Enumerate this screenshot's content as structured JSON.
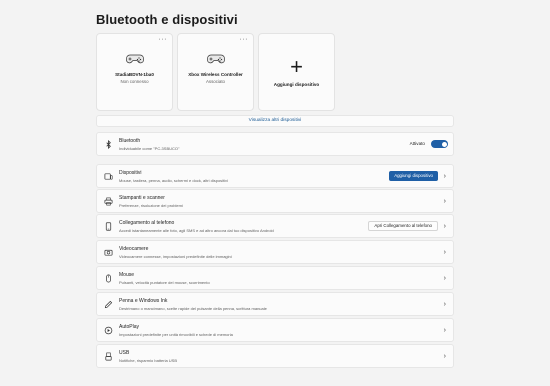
{
  "page": {
    "title": "Bluetooth e dispositivi"
  },
  "devices": [
    {
      "name": "StadiaBDVN-1ba0",
      "status": "Non connesso",
      "icon": "gamepad-icon"
    },
    {
      "name": "Xbox Wireless Controller",
      "status": "Associato",
      "icon": "gamepad-icon"
    }
  ],
  "add_card": {
    "label": "Aggiungi dispositivo",
    "icon": "plus-icon"
  },
  "view_more": "Visualizza altri dispositivi",
  "bluetooth": {
    "title": "Bluetooth",
    "desc": "Individuabile come \"PC-3SBUCO\"",
    "toggle_label": "Attivato",
    "toggle_on": true
  },
  "rows": [
    {
      "id": "dispositivi",
      "title": "Dispositivi",
      "desc": "Mouse, tastiera, penna, audio, schermi e dock, altri dispositivi",
      "button": "Aggiungi dispositivo",
      "button_style": "accent"
    },
    {
      "id": "stampanti",
      "title": "Stampanti e scanner",
      "desc": "Preferenze, risoluzione dei problemi"
    },
    {
      "id": "telefono",
      "title": "Collegamento al telefono",
      "desc": "Accedi istantaneamente alle foto, agli SMS e ad altro ancora dal tuo dispositivo Android",
      "button": "Apri Collegamento al telefono",
      "button_style": "standard"
    },
    {
      "id": "videocamere",
      "title": "Videocamere",
      "desc": "Videocamere connesse, impostazioni predefinite delle immagini"
    },
    {
      "id": "mouse",
      "title": "Mouse",
      "desc": "Pulsanti, velocità puntatore del mouse, scorrimento"
    },
    {
      "id": "penna",
      "title": "Penna e Windows Ink",
      "desc": "Destrimano o mancimano, scelte rapide del pulsante della penna, scrittura manuale"
    },
    {
      "id": "autoplay",
      "title": "AutoPlay",
      "desc": "Impostazioni predefinite per unità rimovibili e schede di memoria"
    },
    {
      "id": "usb",
      "title": "USB",
      "desc": "Notifiche, risparmio batteria USB"
    }
  ],
  "colors": {
    "accent": "#1f5fa6",
    "background": "#f3f3f3",
    "card": "#fbfbfb"
  }
}
